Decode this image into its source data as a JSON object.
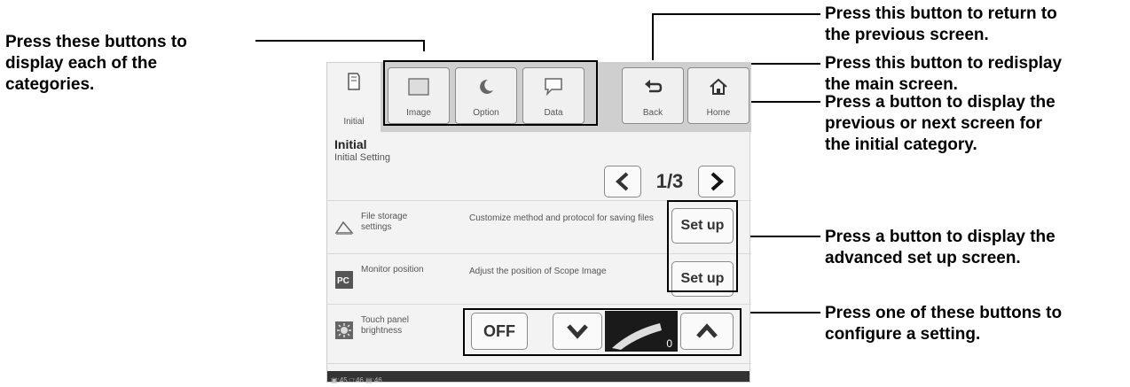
{
  "callouts": {
    "categories": [
      "Press these buttons to",
      "display each of the",
      "categories."
    ],
    "back": [
      "Press this button to return to",
      "the previous screen."
    ],
    "home": [
      "Press this button to redisplay",
      "the main screen."
    ],
    "page_nav": [
      "Press a button to display the",
      "previous or next screen for",
      "the initial category."
    ],
    "setup": [
      "Press a button to display the",
      "advanced set up screen."
    ],
    "setting": [
      "Press one of these buttons to",
      "configure a setting."
    ]
  },
  "screen": {
    "tabs": [
      {
        "label": "Initial",
        "icon": "document-icon",
        "active": true
      },
      {
        "label": "Image",
        "icon": "image-icon",
        "active": false
      },
      {
        "label": "Option",
        "icon": "moon-option-icon",
        "active": false
      },
      {
        "label": "Data",
        "icon": "speech-bubble-icon",
        "active": false
      }
    ],
    "back": {
      "label": "Back",
      "icon": "back-arrow-icon"
    },
    "home": {
      "label": "Home",
      "icon": "home-icon"
    },
    "section_title": "Initial",
    "section_subtitle": "Initial Setting",
    "page_indicator": "1/3",
    "rows": [
      {
        "label": "File storage settings",
        "desc": "Customize method and protocol for saving files",
        "icon": "file-storage-icon",
        "button": "Set up"
      },
      {
        "label": "Monitor position",
        "desc": "Adjust the position of Scope Image",
        "icon": "pc-monitor-icon",
        "button": "Set up"
      },
      {
        "label": "Touch panel brightness",
        "desc": "",
        "icon": "brightness-icon"
      }
    ],
    "brightness_off": "OFF",
    "brightness_value": "0",
    "status_text": "▣:45 □:46 ▤:46"
  },
  "colors": {
    "line": "#000000",
    "tabbar": "#cfcfcf",
    "screen_bg": "#f3f3f3"
  }
}
